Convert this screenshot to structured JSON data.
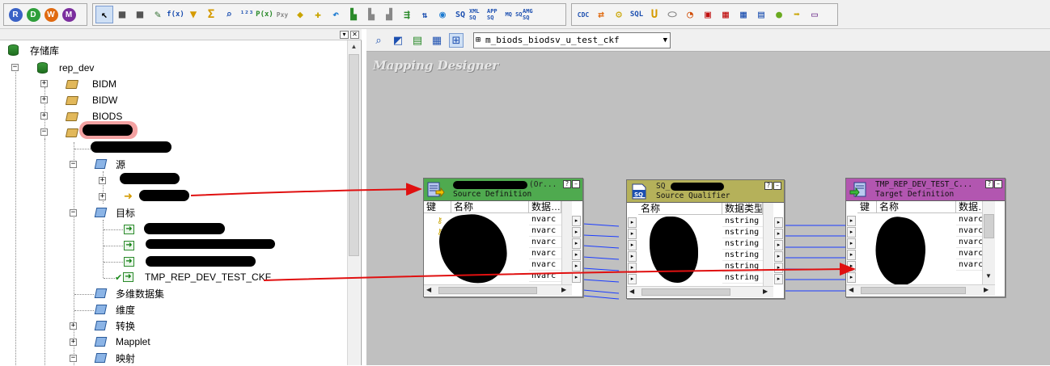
{
  "toolbar": {
    "circle_buttons": [
      {
        "letter": "R",
        "color": "#3a62c6"
      },
      {
        "letter": "D",
        "color": "#2e9e3a"
      },
      {
        "letter": "W",
        "color": "#e06a10"
      },
      {
        "letter": "M",
        "color": "#7b2e9e"
      }
    ],
    "tool_labels": [
      "f(x)",
      "Σ",
      "¹²³",
      "P(x)",
      "SQ",
      "XML SQ",
      "APP SQ",
      "MQ SQ",
      "AMG SQ",
      "CDC",
      "SQL",
      "U"
    ]
  },
  "navigator": {
    "repository_label": "存储库",
    "tree": {
      "repo": "rep_dev",
      "folders": [
        "BIDM",
        "BIDW",
        "BIODS"
      ],
      "nodes": {
        "source": "源",
        "target": "目标",
        "target_visible_item": "TMP_REP_DEV_TEST_CKF",
        "cubes": "多维数据集",
        "dimensions": "维度",
        "transformations": "转换",
        "mapplet": "Mapplet",
        "mappings": "映射"
      }
    }
  },
  "designer": {
    "mapping_name": "m_biods_biodsv_u_test_ckf",
    "title": "Mapping Designer",
    "source_def": {
      "title_suffix": "(Or...",
      "subtitle": "Source Definition",
      "col_key": "键",
      "col_name": "名称",
      "col_type": "数据…",
      "types": [
        "nvarc",
        "nvarc",
        "nvarc",
        "nvarc",
        "nvarc",
        "nvarc"
      ]
    },
    "source_qualifier": {
      "title": "SQ_",
      "subtitle": "Source Qualifier",
      "col_name": "名称",
      "col_type": "数据类型",
      "types": [
        "nstring",
        "nstring",
        "nstring",
        "nstring",
        "nstring",
        "nstring"
      ]
    },
    "target_def": {
      "title": "TMP_REP_DEV_TEST_C...",
      "subtitle": "Target Definition",
      "col_key": "键",
      "col_name": "名称",
      "col_type": "数据…",
      "types": [
        "nvarc",
        "nvarc",
        "nvarc",
        "nvarc",
        "nvarc"
      ]
    },
    "colors": {
      "source_header": "#4faa4f",
      "qualifier_header": "#b5b15a",
      "target_header": "#b256b0",
      "link_blue": "#1a3cff",
      "annotation_red": "#e01010"
    }
  }
}
